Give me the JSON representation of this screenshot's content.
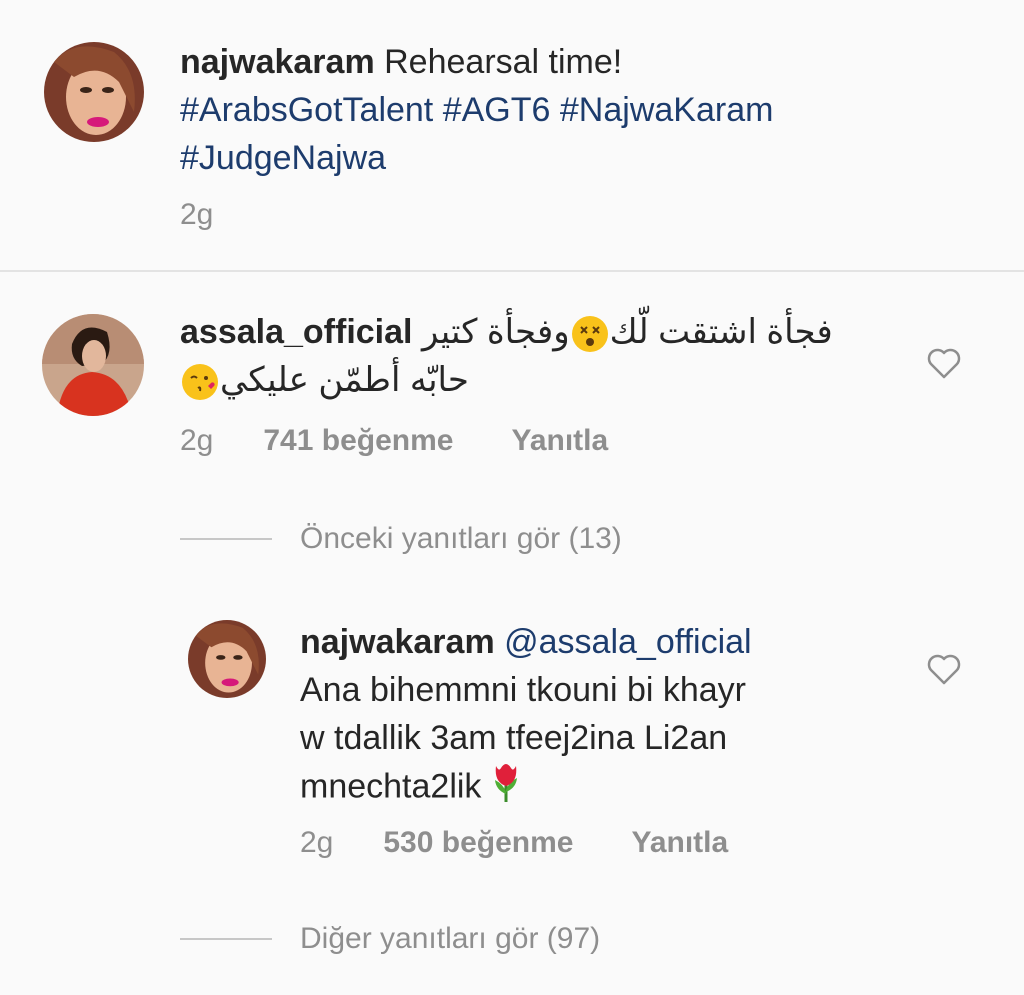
{
  "post": {
    "username": "najwakaram",
    "caption": "Rehearsal time!",
    "hashtags": [
      "#ArabsGotTalent",
      "#AGT6",
      "#NajwaKaram",
      "#JudgeNajwa"
    ],
    "time": "2g"
  },
  "comment": {
    "username": "assala_official",
    "text_part1": "فجأة اشتقت لّك",
    "text_part2": "وفجأة كتير",
    "text_line2": "حابّه أطمّن عليكي",
    "time": "2g",
    "likes": "741 beğenme",
    "reply_label": "Yanıtla",
    "emoji1": "dizzy-face-emoji",
    "emoji2": "kissing-heart-emoji"
  },
  "previous_replies": "Önceki yanıtları gör (13)",
  "reply": {
    "username": "najwakaram",
    "mention": "@assala_official",
    "line1": "Ana bihemmni tkouni bi khayr",
    "line2": "w tdallik 3am tfeej2ina Li2an",
    "line3": "mnechta2lik",
    "time": "2g",
    "likes": "530 beğenme",
    "reply_label": "Yanıtla",
    "emoji": "tulip-emoji"
  },
  "more_replies": "Diğer yanıtları gör (97)",
  "colors": {
    "background": "#fafafa",
    "text": "#262626",
    "hashtag": "#1d3c6d",
    "secondary": "#8e8e8e"
  }
}
